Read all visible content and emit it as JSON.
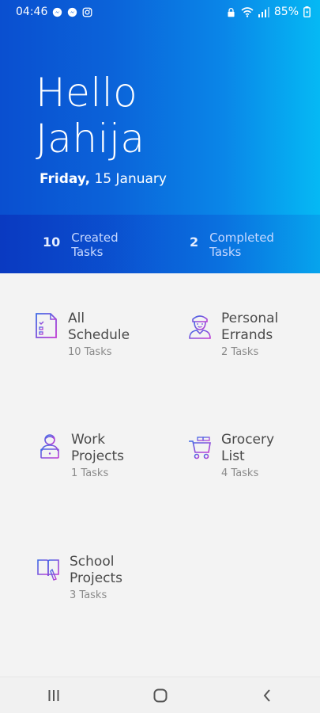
{
  "status_bar": {
    "time": "04:46",
    "battery": "85%",
    "icons": [
      "messenger-icon",
      "messenger-icon",
      "instagram-icon",
      "lock-icon",
      "wifi-icon",
      "signal-icon",
      "battery-icon"
    ]
  },
  "header": {
    "greeting_line1": "Hello",
    "greeting_line2": "Jahija",
    "day": "Friday,",
    "date": "15 January"
  },
  "stats": {
    "created_count": "10",
    "created_label_line1": "Created",
    "created_label_line2": "Tasks",
    "completed_count": "2",
    "completed_label_line1": "Completed",
    "completed_label_line2": "Tasks"
  },
  "categories": [
    {
      "line1": "All",
      "line2": "Schedule",
      "count": "10 Tasks",
      "icon": "checklist-icon"
    },
    {
      "line1": "Personal",
      "line2": "Errands",
      "count": "2 Tasks",
      "icon": "person-icon"
    },
    {
      "line1": "Work",
      "line2": "Projects",
      "count": "1 Tasks",
      "icon": "laptop-user-icon"
    },
    {
      "line1": "Grocery",
      "line2": "List",
      "count": "4 Tasks",
      "icon": "cart-icon"
    },
    {
      "line1": "School",
      "line2": "Projects",
      "count": "3 Tasks",
      "icon": "book-icon"
    }
  ],
  "colors": {
    "gradient_start": "#0a4fd0",
    "gradient_end": "#05b9f4",
    "icon_accent": "#b43ad8",
    "icon_blue": "#3f6be6"
  }
}
